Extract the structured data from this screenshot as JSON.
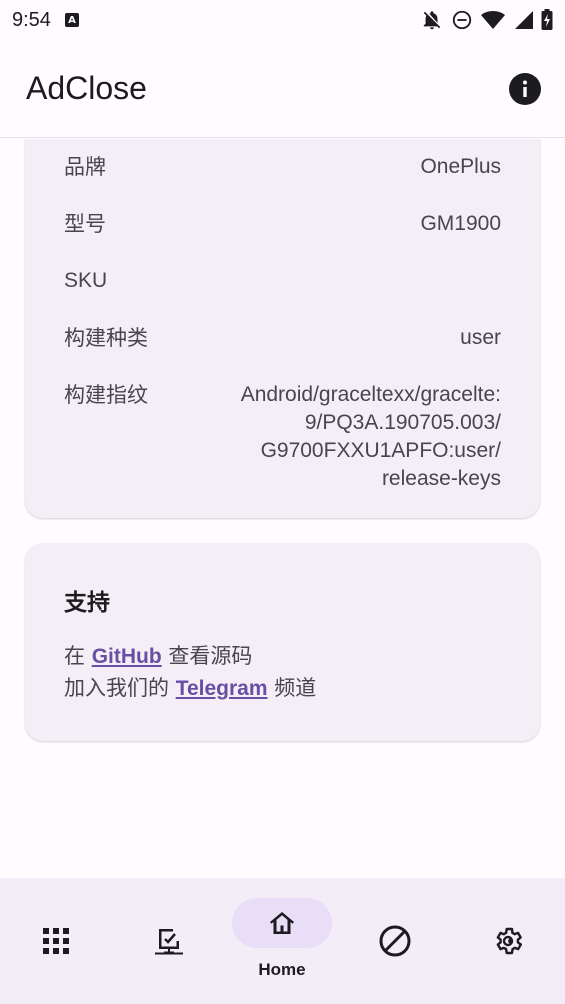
{
  "status_bar": {
    "time": "9:54",
    "icons": [
      "a-notification-icon",
      "notifications-off-icon",
      "dnd-icon",
      "wifi-icon",
      "signal-icon",
      "battery-icon"
    ]
  },
  "app_bar": {
    "title": "AdClose",
    "info_icon": "info-icon"
  },
  "device_info": {
    "rows": [
      {
        "key": "品牌",
        "value": "OnePlus"
      },
      {
        "key": "型号",
        "value": "GM1900"
      },
      {
        "key": "SKU",
        "value": ""
      },
      {
        "key": "构建种类",
        "value": "user"
      },
      {
        "key": "构建指纹",
        "value_lines": [
          "Android/graceltexx/gracelte:",
          "9/PQ3A.190705.003/",
          "G9700FXXU1APFO:user/",
          "release-keys"
        ]
      }
    ]
  },
  "support": {
    "title": "支持",
    "line1": {
      "prefix": "在 ",
      "link": "GitHub",
      "suffix": " 查看源码"
    },
    "line2": {
      "prefix": "加入我们的 ",
      "link": "Telegram",
      "suffix": " 频道"
    }
  },
  "bottom_nav": {
    "items": [
      {
        "icon": "apps-grid-icon",
        "label": ""
      },
      {
        "icon": "install-desktop-icon",
        "label": ""
      },
      {
        "icon": "home-icon",
        "label": "Home",
        "active": true
      },
      {
        "icon": "block-icon",
        "label": ""
      },
      {
        "icon": "settings-gear-icon",
        "label": ""
      }
    ]
  },
  "colors": {
    "background": "#fffbff",
    "card": "#f4eff7",
    "nav": "#f3edf7",
    "active_indicator": "#e8def8",
    "link": "#6750a4"
  }
}
